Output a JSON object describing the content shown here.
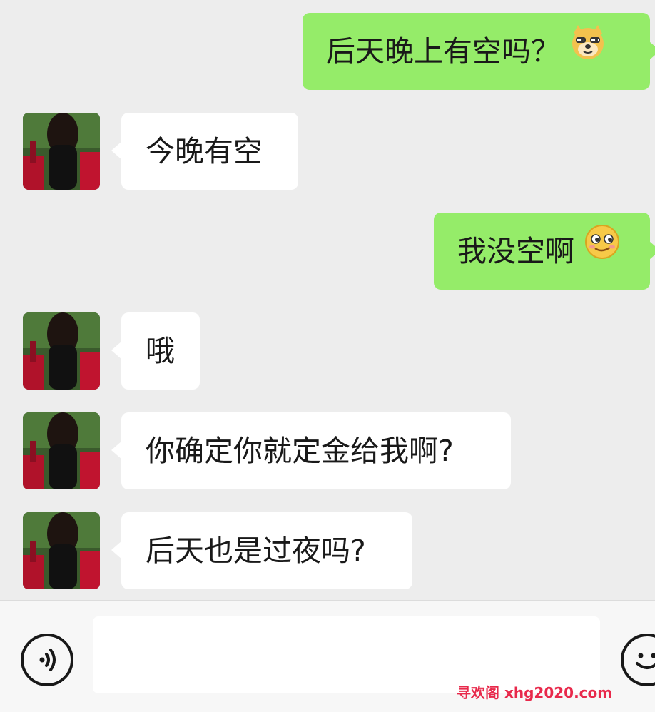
{
  "messages": [
    {
      "side": "sent",
      "text": "后天晚上有空吗？",
      "emoji": "doge-emoji"
    },
    {
      "side": "received",
      "text": "今晚有空"
    },
    {
      "side": "sent",
      "text": "我没空啊",
      "emoji": "smirk-emoji"
    },
    {
      "side": "received",
      "text": "哦"
    },
    {
      "side": "received",
      "text": "你确定你就定金给我啊?"
    },
    {
      "side": "received",
      "text": "后天也是过夜吗?"
    }
  ],
  "composer": {
    "input_value": "",
    "voice_icon": "voice-icon",
    "emoji_icon": "emoji-icon"
  },
  "watermark": "寻欢阁 xhg2020.com",
  "colors": {
    "background": "#ededed",
    "sent_bubble": "#95ec69",
    "received_bubble": "#ffffff",
    "watermark": "#e8294b"
  }
}
